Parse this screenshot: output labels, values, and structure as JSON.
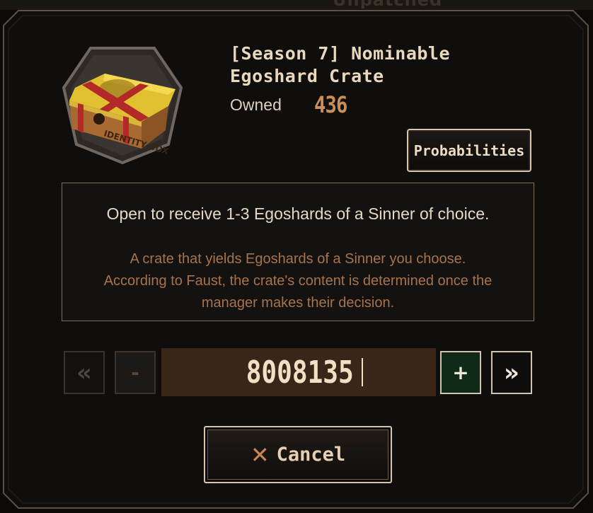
{
  "background": {
    "title_fragment": "Unpatched"
  },
  "item": {
    "title": "[Season 7] Nominable Egoshard Crate",
    "owned_label": "Owned",
    "owned_value": "436",
    "crate_icon": "identity-box-crate-icon"
  },
  "buttons": {
    "probabilities": "Probabilities",
    "cancel": "Cancel",
    "cancel_icon": "x-icon"
  },
  "description": {
    "main": "Open to receive 1-3 Egoshards of a Sinner of choice.",
    "lines": [
      "A crate that yields Egoshards of a Sinner you choose.",
      "According to Faust, the crate's content is determined once the",
      "manager makes their decision."
    ]
  },
  "quantity": {
    "value": "8008135",
    "min_symbol": "«",
    "decrement_symbol": "-",
    "increment_symbol": "+",
    "max_symbol": "»"
  },
  "colors": {
    "accent": "#c98f5a",
    "increment_bg": "#0f2a16",
    "field_bg": "#3a2618"
  }
}
